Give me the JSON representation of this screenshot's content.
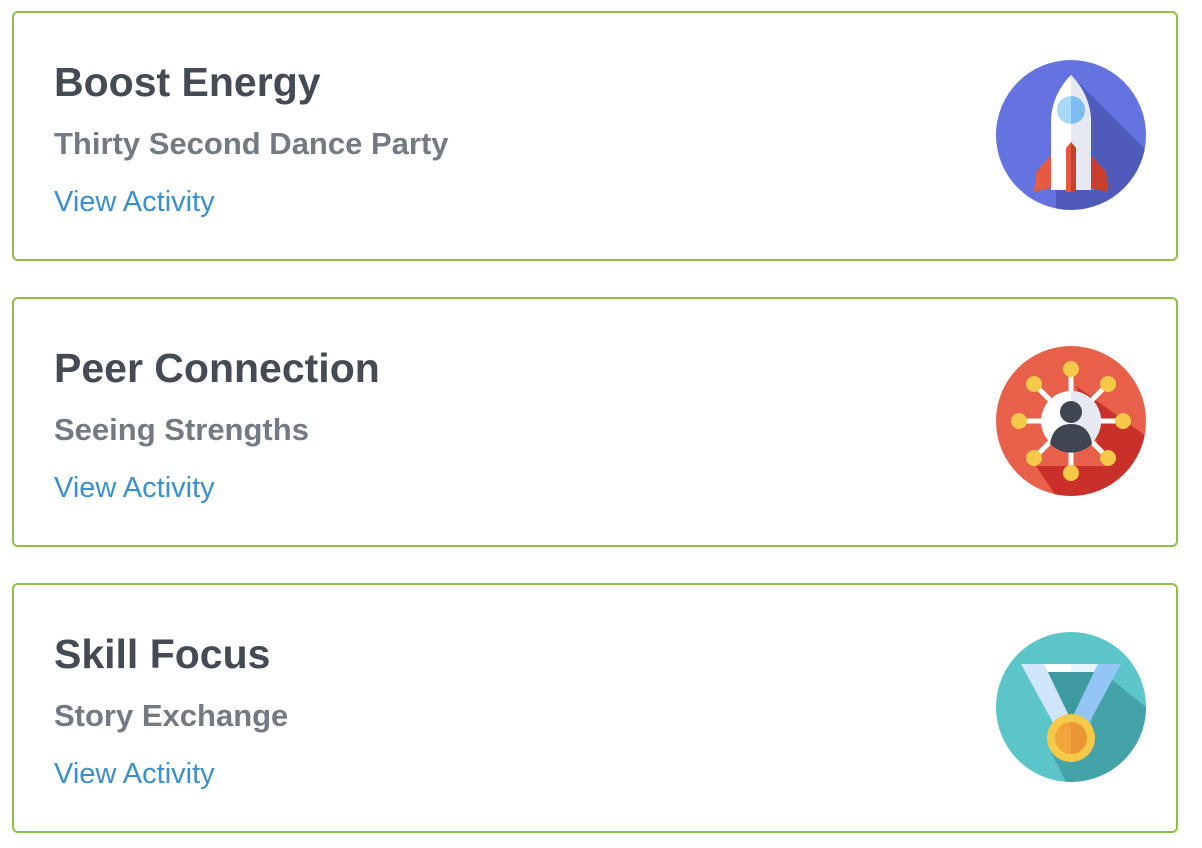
{
  "cards": [
    {
      "title": "Boost Energy",
      "subtitle": "Thirty Second Dance Party",
      "link_label": "View Activity",
      "icon": "rocket-icon",
      "icon_color": "#6573e0"
    },
    {
      "title": "Peer Connection",
      "subtitle": "Seeing Strengths",
      "link_label": "View Activity",
      "icon": "network-person-icon",
      "icon_color": "#e8604a"
    },
    {
      "title": "Skill Focus",
      "subtitle": "Story Exchange",
      "link_label": "View Activity",
      "icon": "medal-icon",
      "icon_color": "#5bc5c9"
    }
  ],
  "colors": {
    "card_border": "#8dc045",
    "title": "#454b54",
    "subtitle": "#747a82",
    "link": "#3b8fcc"
  }
}
